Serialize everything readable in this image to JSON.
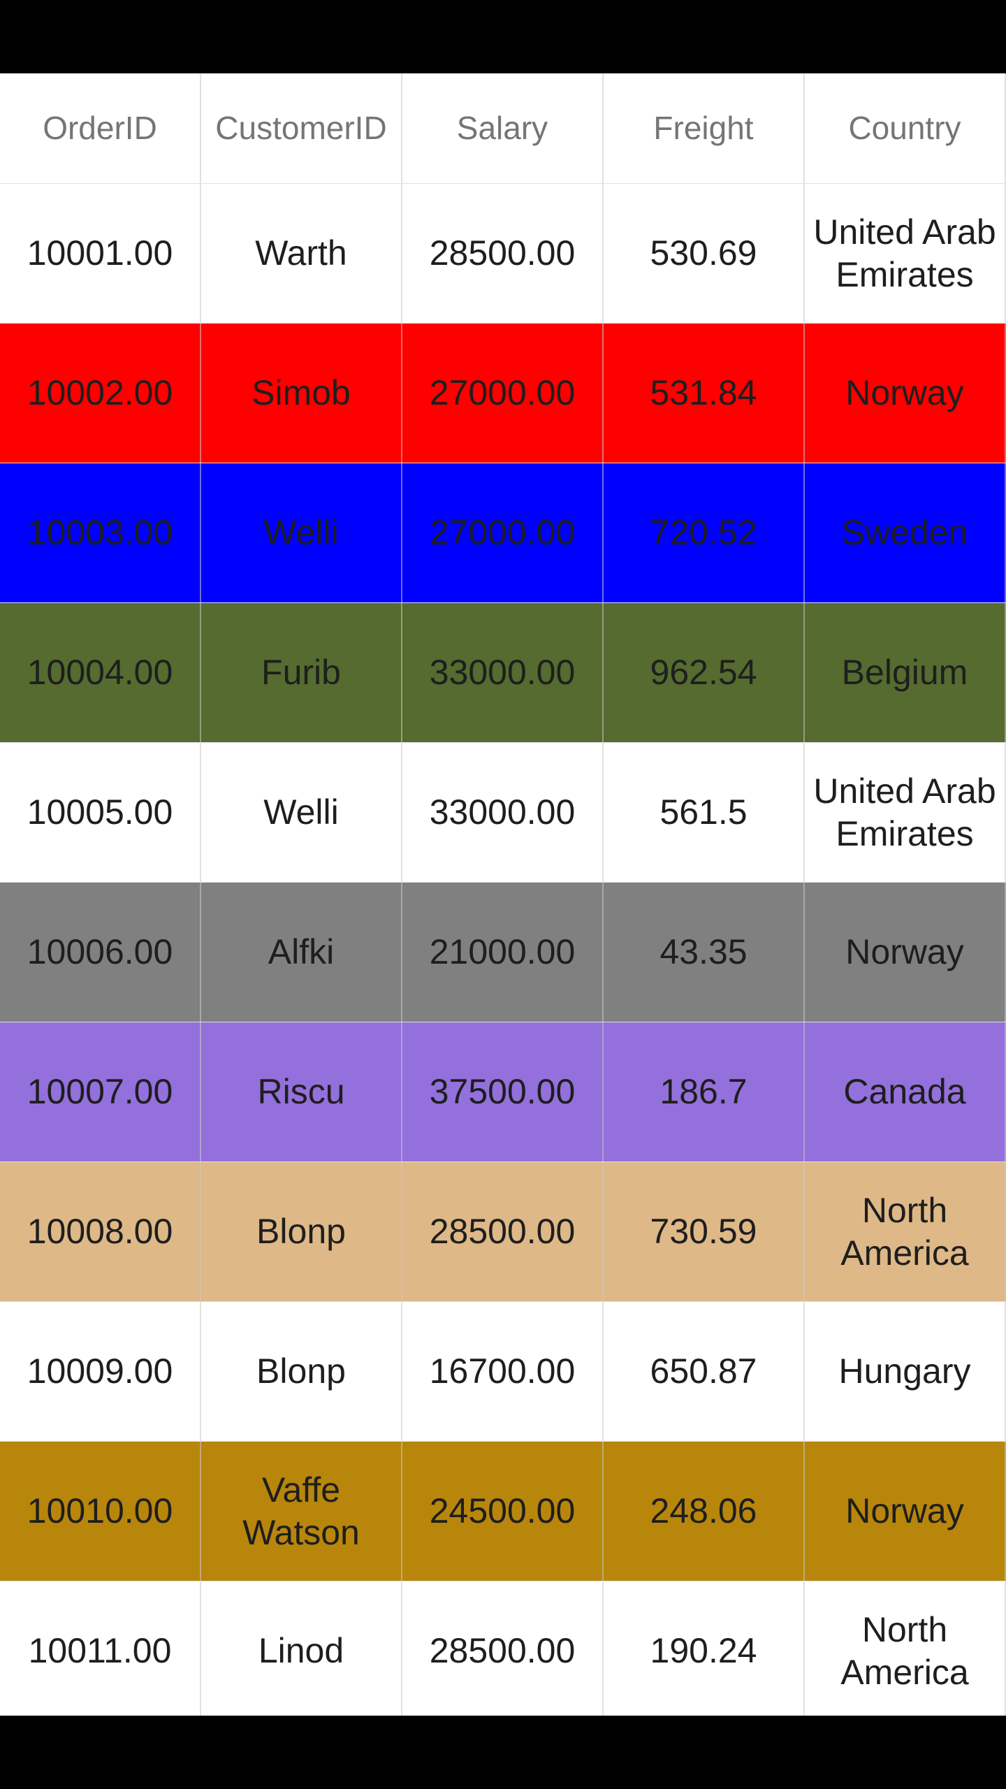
{
  "columns": [
    "OrderID",
    "CustomerID",
    "Salary",
    "Freight",
    "Country"
  ],
  "rows": [
    {
      "bg": "#ffffff",
      "cells": [
        "10001.00",
        "Warth",
        "28500.00",
        "530.69",
        "United Arab Emirates"
      ]
    },
    {
      "bg": "#ff0000",
      "cells": [
        "10002.00",
        "Simob",
        "27000.00",
        "531.84",
        "Norway"
      ]
    },
    {
      "bg": "#0000ff",
      "cells": [
        "10003.00",
        "Welli",
        "27000.00",
        "720.52",
        "Sweden"
      ]
    },
    {
      "bg": "#556b2f",
      "cells": [
        "10004.00",
        "Furib",
        "33000.00",
        "962.54",
        "Belgium"
      ]
    },
    {
      "bg": "#ffffff",
      "cells": [
        "10005.00",
        "Welli",
        "33000.00",
        "561.5",
        "United Arab Emirates"
      ]
    },
    {
      "bg": "#808080",
      "cells": [
        "10006.00",
        "Alfki",
        "21000.00",
        "43.35",
        "Norway"
      ]
    },
    {
      "bg": "#9370db",
      "cells": [
        "10007.00",
        "Riscu",
        "37500.00",
        "186.7",
        "Canada"
      ]
    },
    {
      "bg": "#deb887",
      "cells": [
        "10008.00",
        "Blonp",
        "28500.00",
        "730.59",
        "North America"
      ]
    },
    {
      "bg": "#ffffff",
      "cells": [
        "10009.00",
        "Blonp",
        "16700.00",
        "650.87",
        "Hungary"
      ]
    },
    {
      "bg": "#b8860b",
      "cells": [
        "10010.00",
        "Vaffe Watson",
        "24500.00",
        "248.06",
        "Norway"
      ]
    },
    {
      "bg": "#ffffff",
      "cells": [
        "10011.00",
        "Linod",
        "28500.00",
        "190.24",
        "North America"
      ]
    }
  ]
}
